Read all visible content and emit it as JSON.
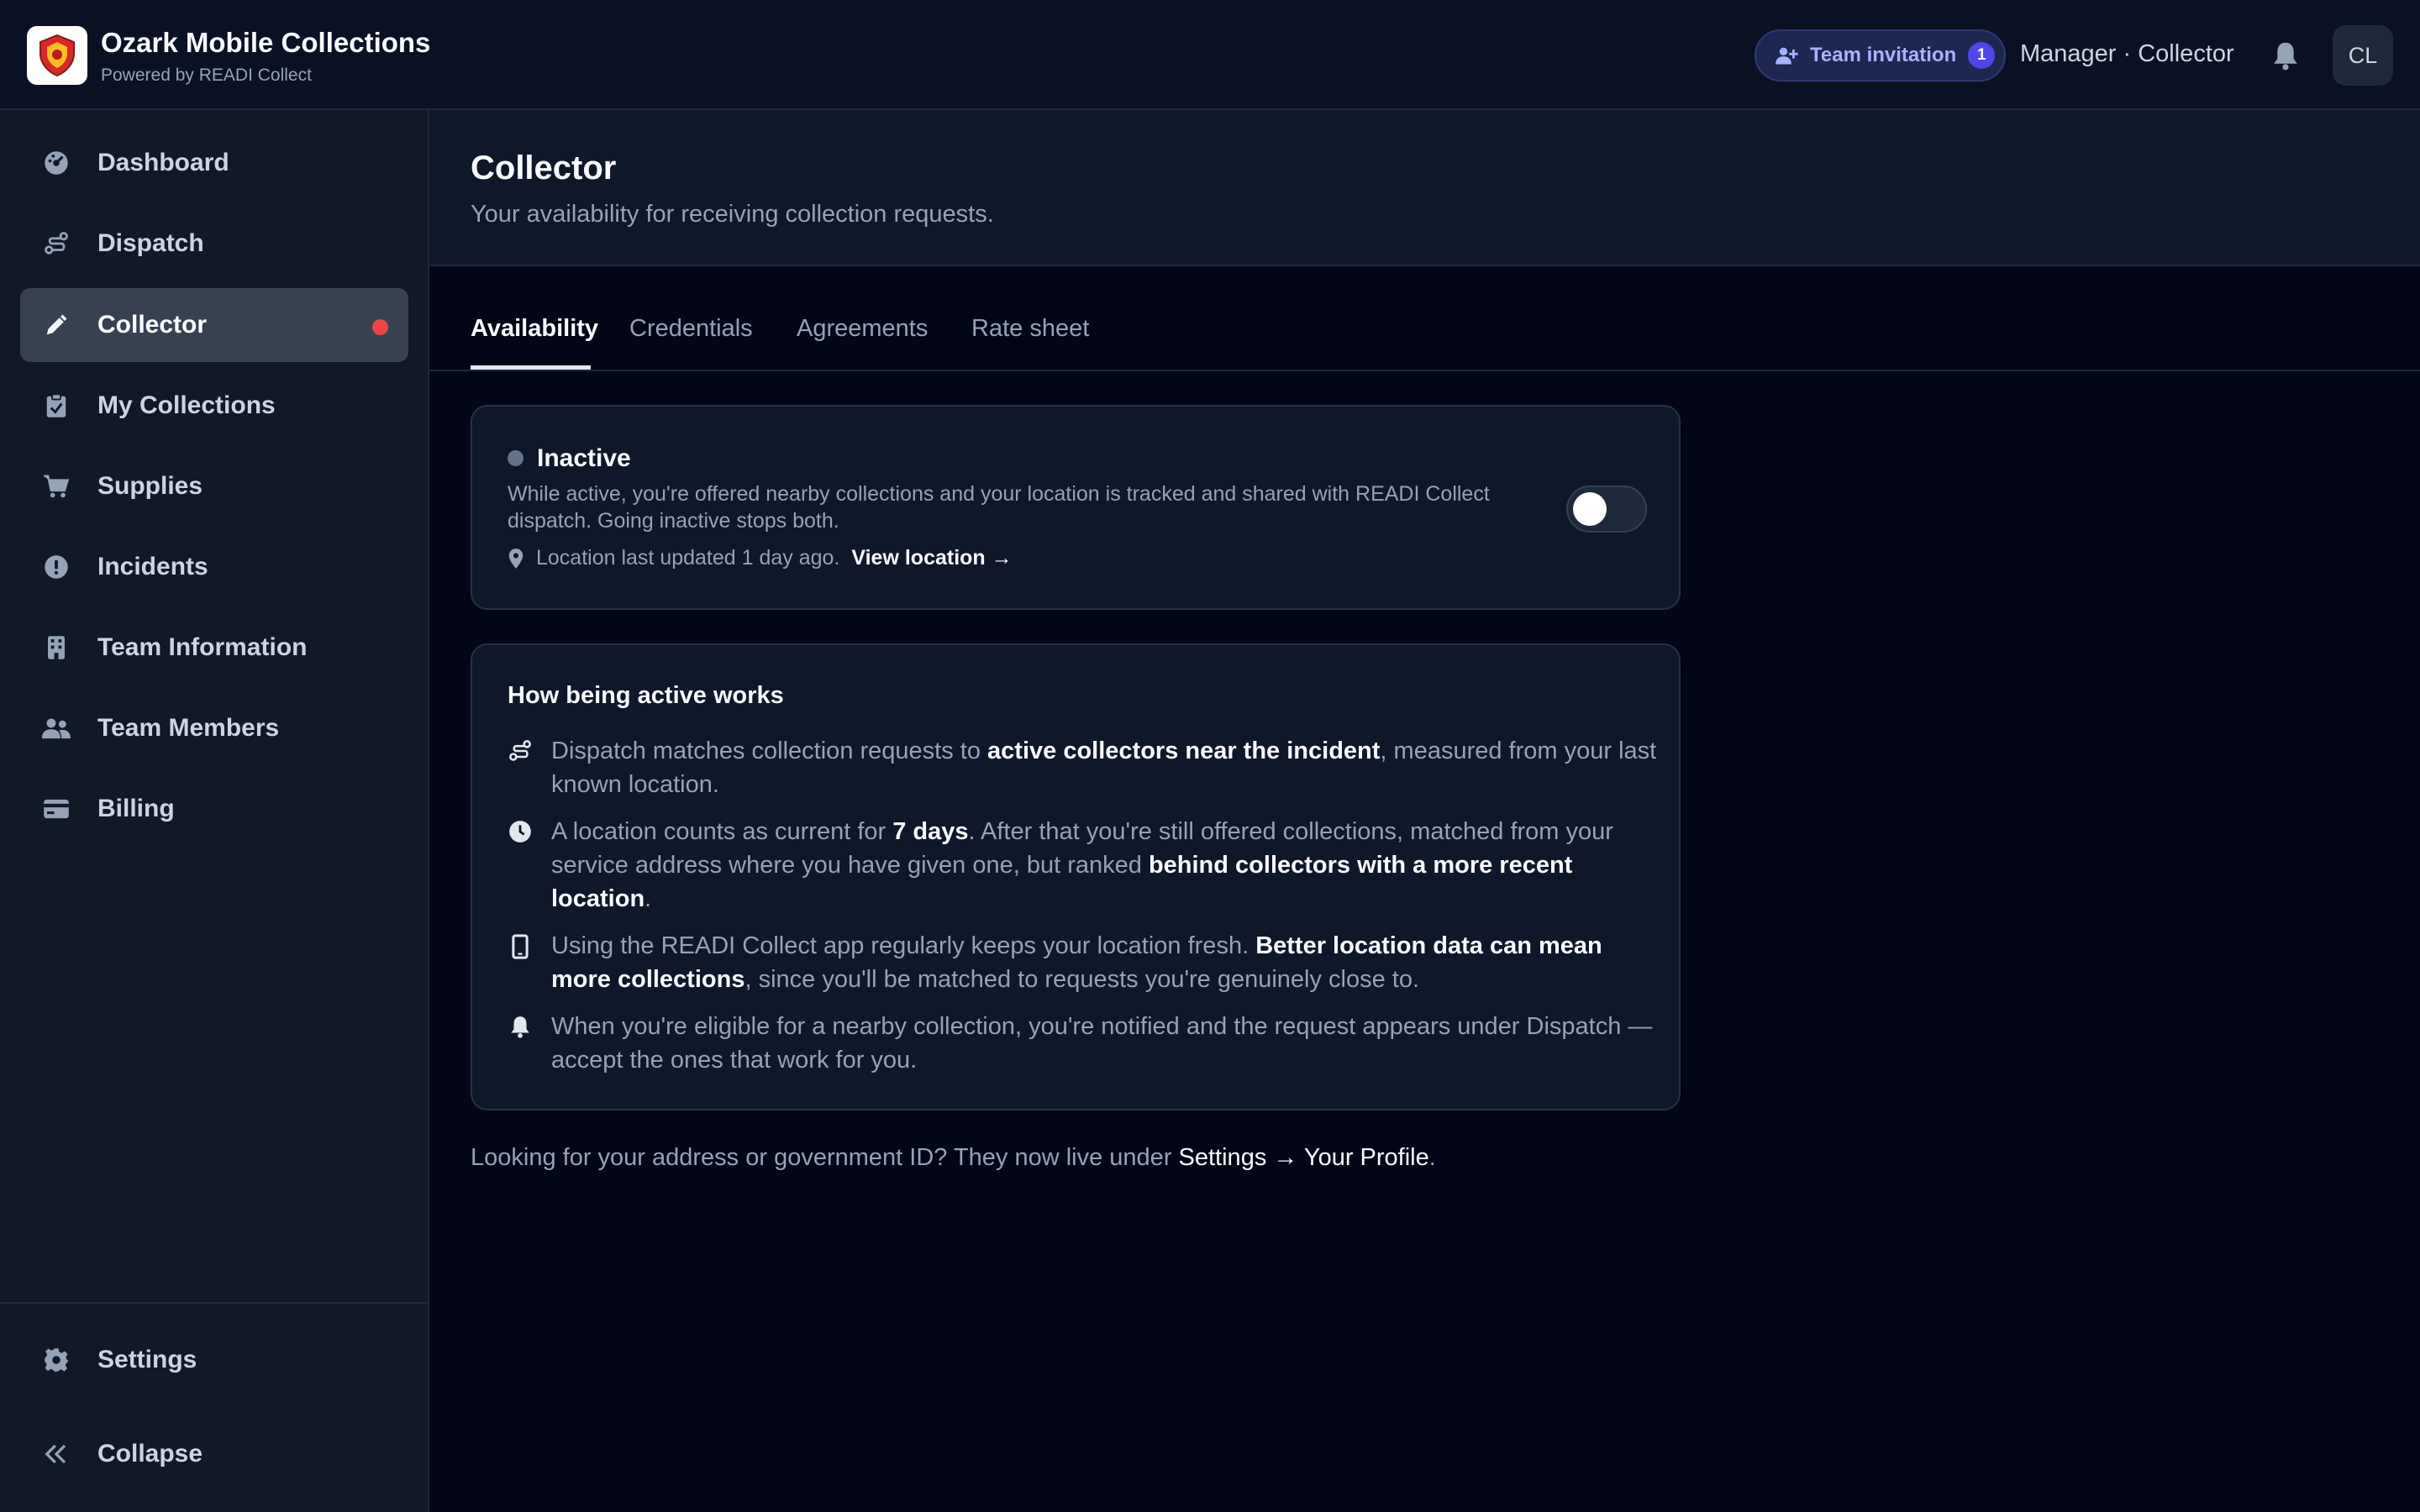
{
  "app": {
    "title": "Ozark Mobile Collections",
    "subtitle": "Powered by READI Collect"
  },
  "header": {
    "invitation_label": "Team invitation",
    "invitation_count": "1",
    "role": "Manager · Collector",
    "avatar_initials": "CL"
  },
  "sidebar": {
    "items": [
      {
        "label": "Dashboard",
        "icon": "dashboard-icon"
      },
      {
        "label": "Dispatch",
        "icon": "route-icon"
      },
      {
        "label": "Collector",
        "icon": "pencil-icon",
        "active": true
      },
      {
        "label": "My Collections",
        "icon": "clipboard-check-icon"
      },
      {
        "label": "Supplies",
        "icon": "cart-icon"
      },
      {
        "label": "Incidents",
        "icon": "alert-circle-icon"
      },
      {
        "label": "Team Information",
        "icon": "building-icon"
      },
      {
        "label": "Team Members",
        "icon": "users-icon"
      },
      {
        "label": "Billing",
        "icon": "credit-card-icon"
      }
    ],
    "settings_label": "Settings",
    "collapse_label": "Collapse"
  },
  "page": {
    "title": "Collector",
    "subtitle": "Your availability for receiving collection requests."
  },
  "tabs": [
    {
      "label": "Availability",
      "active": true
    },
    {
      "label": "Credentials"
    },
    {
      "label": "Agreements"
    },
    {
      "label": "Rate sheet"
    }
  ],
  "status": {
    "label": "Inactive",
    "description": "While active, you're offered nearby collections and your location is tracked and shared with READI Collect dispatch. Going inactive stops both.",
    "location_text": "Location last updated 1 day ago.",
    "location_link": "View location →",
    "toggle_on": false
  },
  "how": {
    "title": "How being active works",
    "items": [
      {
        "icon": "route-icon",
        "parts": [
          "Dispatch matches collection requests to ",
          "active collectors near the incident",
          ", measured from your last known location."
        ]
      },
      {
        "icon": "clock-icon",
        "parts": [
          "A location counts as current for ",
          "7 days",
          ". After that you're still offered collections, matched from your service address where you have given one, but ranked ",
          "behind collectors with a more recent location",
          "."
        ]
      },
      {
        "icon": "phone-icon",
        "parts": [
          "Using the READI Collect app regularly keeps your location fresh. ",
          "Better location data can mean more collections",
          ", since you'll be matched to requests you're genuinely close to."
        ]
      },
      {
        "icon": "bell-icon",
        "parts": [
          "When you're eligible for a nearby collection, you're notified and the request appears under Dispatch — accept the ones that work for you."
        ]
      }
    ]
  },
  "footer": {
    "text": "Looking for your address or government ID? They now live under ",
    "link": "Settings → Your Profile",
    "end": "."
  },
  "colors": {
    "background": "#020617",
    "accent": "#4f46e5",
    "alert": "#ef4444"
  }
}
